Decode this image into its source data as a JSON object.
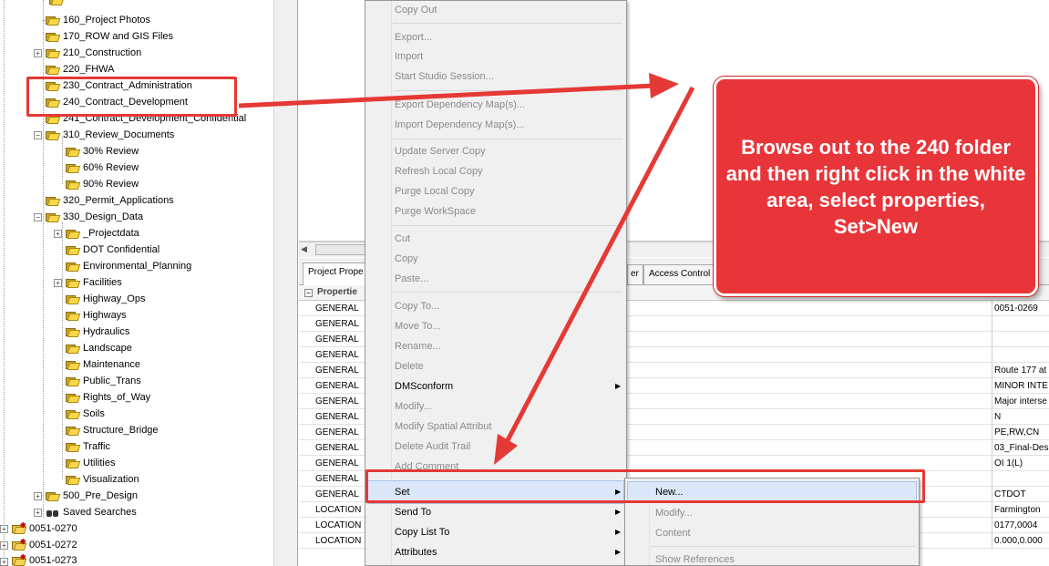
{
  "tree": {
    "items": [
      {
        "label": "160_Project Photos"
      },
      {
        "label": "170_ROW and GIS Files"
      },
      {
        "label": "210_Construction"
      },
      {
        "label": "220_FHWA"
      },
      {
        "label": "230_Contract_Administration"
      },
      {
        "label": "240_Contract_Development"
      },
      {
        "label": "241_Contract_Development_Confidential"
      },
      {
        "label": "310_Review_Documents"
      },
      {
        "label": "30% Review"
      },
      {
        "label": "60% Review"
      },
      {
        "label": "90% Review"
      },
      {
        "label": "320_Permit_Applications"
      },
      {
        "label": "330_Design_Data"
      },
      {
        "label": "_Projectdata"
      },
      {
        "label": "DOT Confidential"
      },
      {
        "label": "Environmental_Planning"
      },
      {
        "label": "Facilities"
      },
      {
        "label": "Highway_Ops"
      },
      {
        "label": "Highways"
      },
      {
        "label": "Hydraulics"
      },
      {
        "label": "Landscape"
      },
      {
        "label": "Maintenance"
      },
      {
        "label": "Public_Trans"
      },
      {
        "label": "Rights_of_Way"
      },
      {
        "label": "Soils"
      },
      {
        "label": "Structure_Bridge"
      },
      {
        "label": "Traffic"
      },
      {
        "label": "Utilities"
      },
      {
        "label": "Visualization"
      },
      {
        "label": "500_Pre_Design"
      },
      {
        "label": "Saved Searches"
      },
      {
        "label": "0051-0270"
      },
      {
        "label": "0051-0272"
      },
      {
        "label": "0051-0273"
      }
    ]
  },
  "tabs": {
    "project_properties": "Project Prope",
    "partial_tab": "er",
    "access_control": "Access Control"
  },
  "grid": {
    "section_label": "Propertie",
    "rows": [
      {
        "c1": "GENERAL",
        "c3": "0051-0269"
      },
      {
        "c1": "GENERAL",
        "c3": ""
      },
      {
        "c1": "GENERAL",
        "c3": ""
      },
      {
        "c1": "GENERAL",
        "c3": ""
      },
      {
        "c1": "GENERAL",
        "c3": "Route 177 at"
      },
      {
        "c1": "GENERAL",
        "c3": "MINOR INTE"
      },
      {
        "c1": "GENERAL",
        "c3": "Major interse"
      },
      {
        "c1": "GENERAL",
        "c3": "N"
      },
      {
        "c1": "GENERAL",
        "c3": "PE,RW,CN"
      },
      {
        "c1": "GENERAL",
        "c3": "03_Final-Des"
      },
      {
        "c1": "GENERAL",
        "c3": "OI 1(L)"
      },
      {
        "c1": "GENERAL",
        "c3": ""
      },
      {
        "c1": "GENERAL",
        "c3": "CTDOT"
      },
      {
        "c1": "LOCATION",
        "c3": "Farmington"
      },
      {
        "c1": "LOCATION",
        "c3": "0177,0004"
      },
      {
        "c1": "LOCATION",
        "c3": "0.000,0.000"
      }
    ]
  },
  "menu": {
    "copy_out": "Copy Out",
    "export": "Export...",
    "import": "Import",
    "start_studio": "Start Studio Session...",
    "export_dep": "Export Dependency Map(s)...",
    "import_dep": "Import Dependency Map(s)...",
    "update_server": "Update Server Copy",
    "refresh_local": "Refresh Local Copy",
    "purge_local": "Purge Local Copy",
    "purge_workspace": "Purge WorkSpace",
    "cut": "Cut",
    "copy": "Copy",
    "paste": "Paste...",
    "copy_to": "Copy To...",
    "move_to": "Move To...",
    "rename": "Rename...",
    "delete": "Delete",
    "dmsconform": "DMSconform",
    "modify": "Modify...",
    "modify_spatial": "Modify Spatial Attribut",
    "delete_audit": "Delete Audit Trail",
    "add_comment": "Add Comment",
    "set": "Set",
    "send_to": "Send To",
    "copy_list_to": "Copy List To",
    "attributes": "Attributes"
  },
  "submenu": {
    "new": "New...",
    "modify": "Modify...",
    "content": "Content",
    "show_references": "Show References"
  },
  "callout": {
    "text": "Browse out to the 240 folder and then right click in the white area, select properties, Set>New"
  },
  "colors": {
    "annotation_red": "#e53935",
    "callout_fill": "#e8353a",
    "menu_highlight": "#dbe8f9",
    "folder_yellow": "#f7d84a"
  }
}
